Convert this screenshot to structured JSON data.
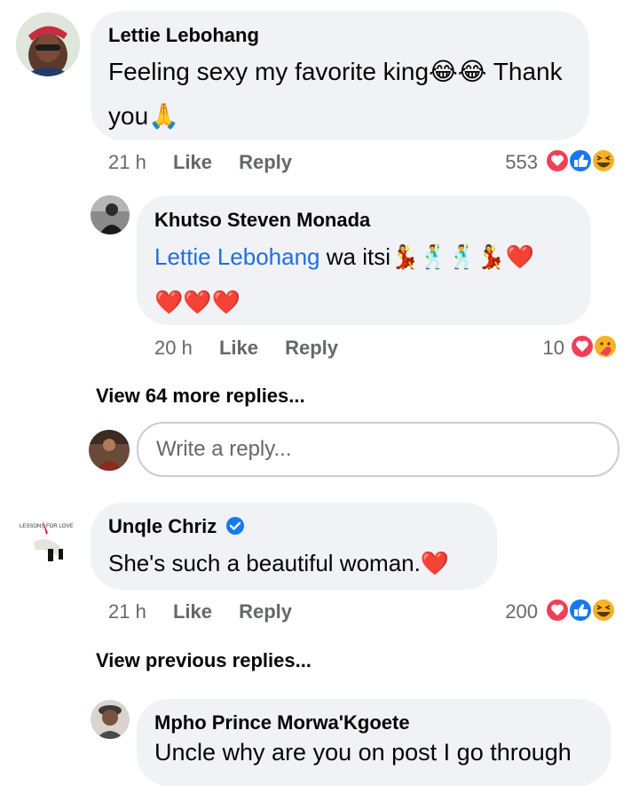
{
  "comments": [
    {
      "author": "Lettie Lebohang",
      "text_line1": "Feeling sexy my favorite king",
      "text_line1_tail": "Thank",
      "text_line2": "you",
      "time": "21 h",
      "like": "Like",
      "reply": "Reply",
      "reaction_count": "553",
      "reactions": [
        "love",
        "like",
        "haha"
      ]
    },
    {
      "author": "Khutso Steven Monada",
      "mention": "Lettie Lebohang",
      "text": " wa itsi",
      "time": "20 h",
      "like": "Like",
      "reply": "Reply",
      "reaction_count": "10",
      "reactions": [
        "love",
        "care"
      ]
    },
    {
      "author": "Unqle Chriz",
      "verified": true,
      "text": "She's such a beautiful woman.",
      "time": "21 h",
      "like": "Like",
      "reply": "Reply",
      "reaction_count": "200",
      "reactions": [
        "love",
        "like",
        "haha"
      ]
    },
    {
      "author": "Mpho Prince Morwa'Kgoete",
      "text": "Uncle why are you on post I go through"
    }
  ],
  "view_more_replies": "View 64 more replies...",
  "view_previous_replies": "View previous replies...",
  "reply_placeholder": "Write a reply...",
  "avatar_logo_text": "LESSONS FOR LOVE",
  "colors": {
    "bubble": "#f0f2f5",
    "link": "#216fdb",
    "meta": "#65676b",
    "love": "#f33e58",
    "like": "#1877f2",
    "haha": "#f7b125"
  }
}
